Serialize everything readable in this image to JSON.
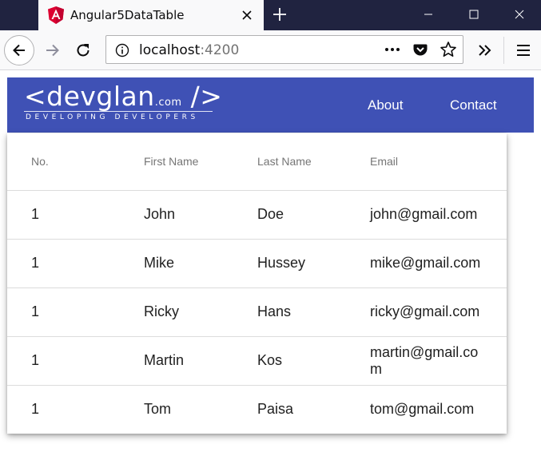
{
  "browser": {
    "tab_title": "Angular5DataTable",
    "url_host": "localhost",
    "url_port": ":4200"
  },
  "navbar": {
    "logo_main": "<devglan",
    "logo_com": ".com",
    "logo_close": "/>",
    "logo_tagline": "DEVELOPING DEVELOPERS",
    "links": [
      "About",
      "Contact"
    ],
    "color": "#3f51b5"
  },
  "table": {
    "headers": [
      "No.",
      "First Name",
      "Last Name",
      "Email"
    ],
    "rows": [
      [
        "1",
        "John",
        "Doe",
        "john@gmail.com"
      ],
      [
        "1",
        "Mike",
        "Hussey",
        "mike@gmail.com"
      ],
      [
        "1",
        "Ricky",
        "Hans",
        "ricky@gmail.com"
      ],
      [
        "1",
        "Martin",
        "Kos",
        "martin@gmail.com"
      ],
      [
        "1",
        "Tom",
        "Paisa",
        "tom@gmail.com"
      ]
    ]
  },
  "icons": {
    "tab": "angular-logo-icon",
    "close": "close-icon",
    "new_tab": "plus-icon",
    "back": "back-arrow-icon",
    "forward": "forward-arrow-icon",
    "reload": "reload-icon",
    "info": "info-icon",
    "page_actions": "more-dots-icon",
    "pocket": "pocket-icon",
    "bookmark": "star-icon",
    "overflow": "double-chevron-icon",
    "menu": "hamburger-menu-icon"
  }
}
